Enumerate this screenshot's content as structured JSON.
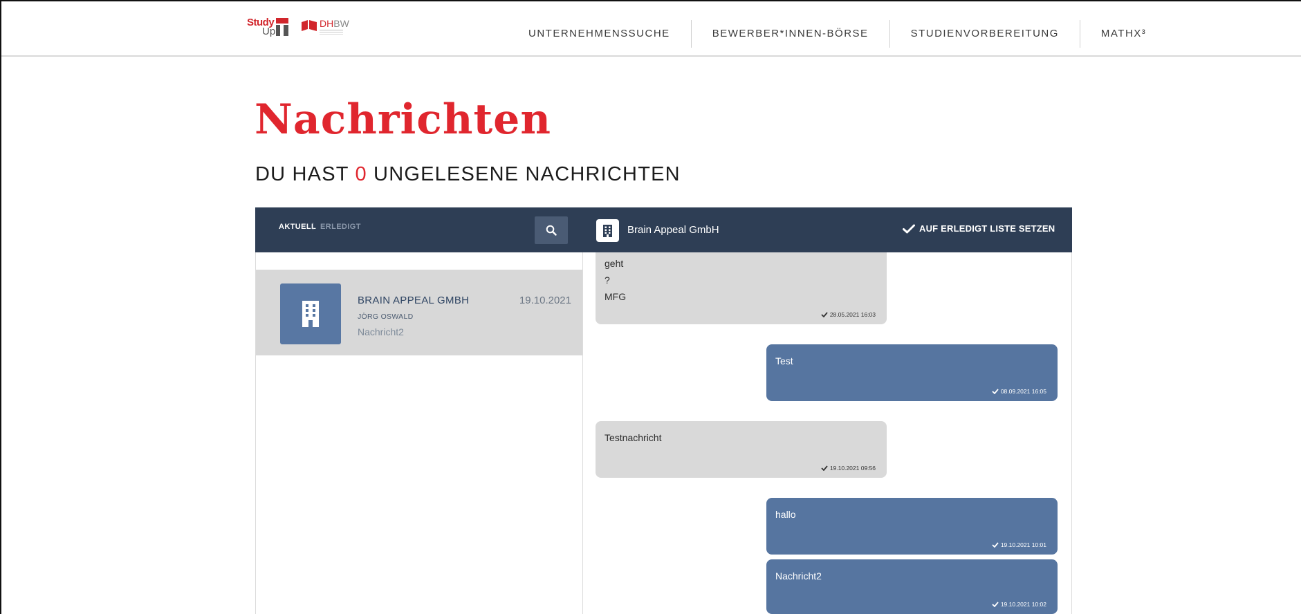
{
  "header": {
    "logo_study_1": "Study",
    "logo_study_2": "Up",
    "logo_dhbw_red": "DH",
    "logo_dhbw_grey": "BW",
    "nav": [
      {
        "label": "UNTERNEHMENSSUCHE"
      },
      {
        "label": "BEWERBER*INNEN-BÖRSE"
      },
      {
        "label": "STUDIENVORBEREITUNG"
      },
      {
        "label": "MATHX³"
      }
    ]
  },
  "page": {
    "title": "Nachrichten",
    "subtitle_pre": "DU HAST",
    "unread_count": "0",
    "subtitle_post": "UNGELESENE NACHRICHTEN"
  },
  "inbox": {
    "tab_active": "AKTUELL",
    "tab_separator": "|",
    "tab_inactive": "ERLEDIGT",
    "search_icon": "search-icon",
    "conversations": [
      {
        "company": "BRAIN APPEAL GMBH",
        "date": "19.10.2021",
        "person": "JÖRG OSWALD",
        "preview": "Nachricht2"
      }
    ]
  },
  "chat": {
    "company": "Brain Appeal GmbH",
    "mark_done_label": "AUF ERLEDIGT LISTE SETZEN",
    "messages": [
      {
        "direction": "in",
        "lines": [
          "geht",
          "?",
          "MFG"
        ],
        "timestamp": "28.05.2021 16:03"
      },
      {
        "direction": "out",
        "lines": [
          "Test"
        ],
        "timestamp": "08.09.2021 16:05"
      },
      {
        "direction": "in",
        "lines": [
          "Testnachricht"
        ],
        "timestamp": "19.10.2021 09:56"
      },
      {
        "direction": "out",
        "lines": [
          "hallo"
        ],
        "timestamp": "19.10.2021 10:01"
      },
      {
        "direction": "out",
        "lines": [
          "Nachricht2"
        ],
        "timestamp": "19.10.2021 10:02"
      }
    ]
  },
  "colors": {
    "accent_red": "#e0262e",
    "navy_bar": "#2e3e55",
    "bubble_out": "#5675a0",
    "bubble_in": "#d9d9d9"
  }
}
